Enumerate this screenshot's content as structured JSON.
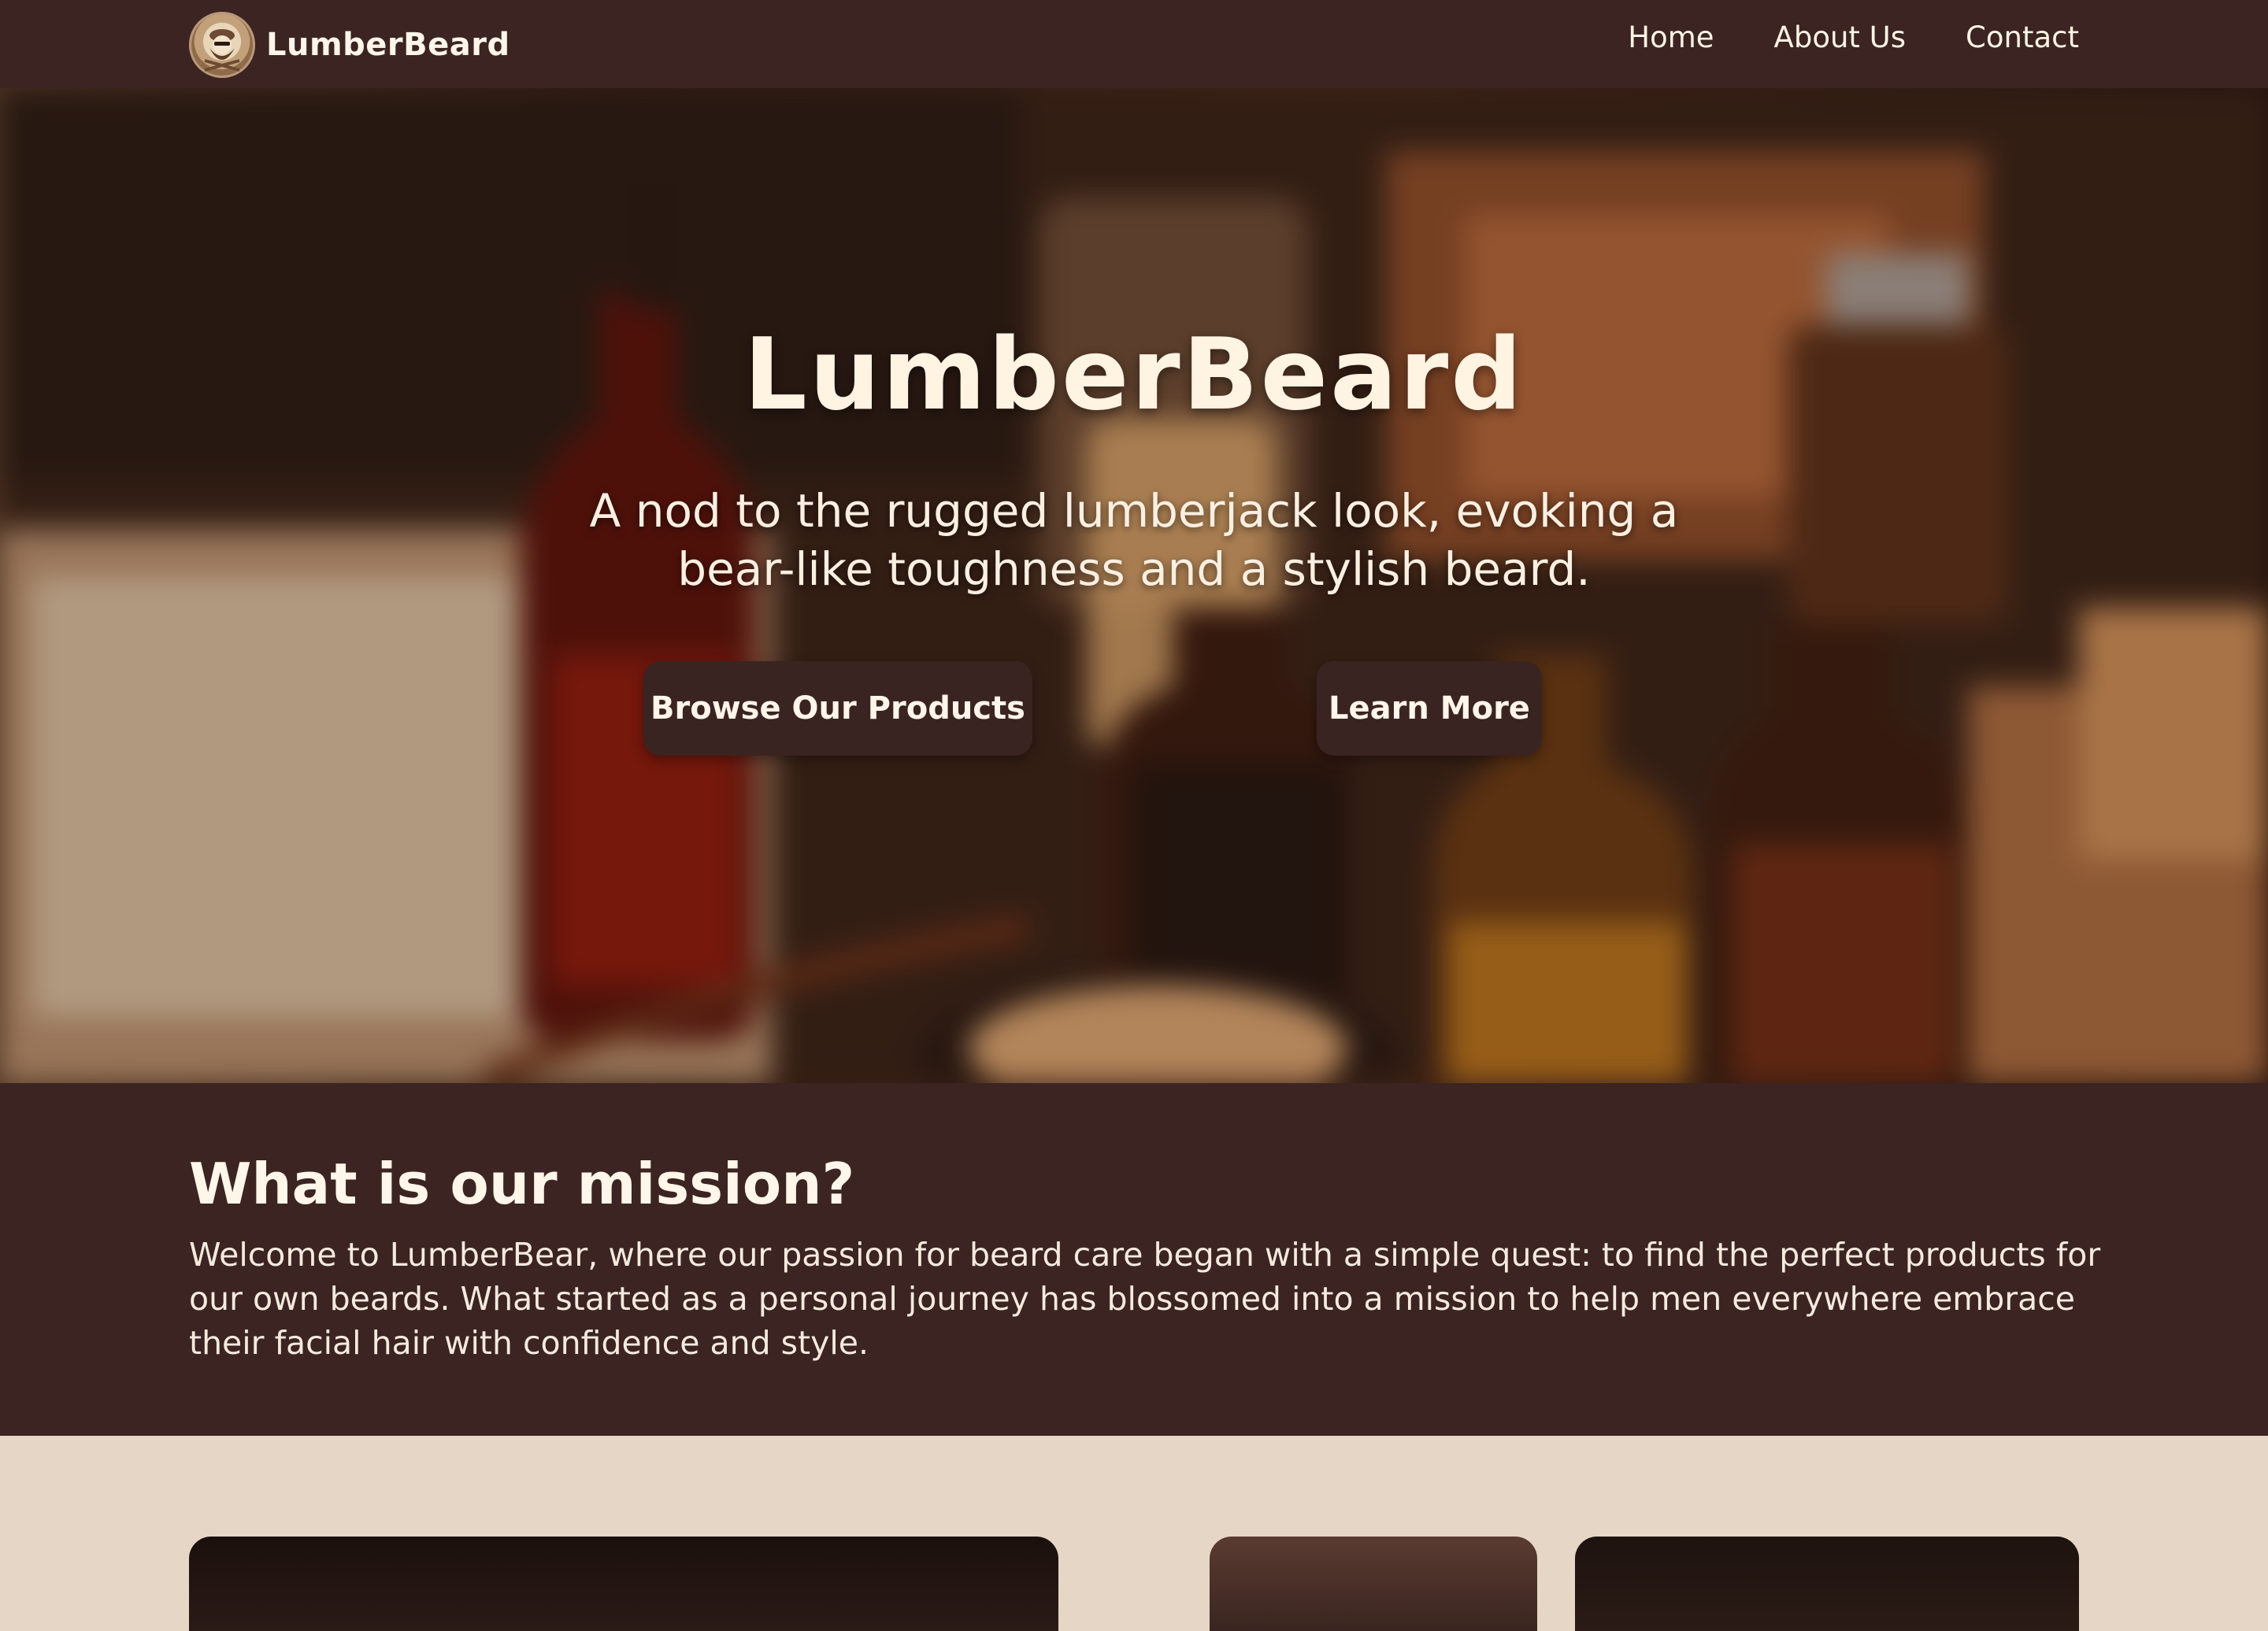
{
  "nav": {
    "brand": "LumberBeard",
    "links": [
      "Home",
      "About Us",
      "Contact"
    ]
  },
  "hero": {
    "title": "LumberBeard",
    "subtitle": "A nod to the rugged lumberjack look, evoking a bear-like toughness and a stylish beard.",
    "buttons": [
      "Browse Our Products",
      "Learn More"
    ]
  },
  "mission": {
    "title": "What is our mission?",
    "text": "Welcome to LumberBear, where our passion for beard care began with a simple quest: to find the perfect products for our own beards. What started as a personal journey has blossomed into a mission to help men everywhere embrace their facial hair with confidence and style."
  },
  "colors": {
    "navbar": "#3b2421",
    "mission_bg": "#3b2421",
    "page_bg": "#e5d6c6",
    "button_bg": "#3a2421",
    "text_light": "#fff5ea"
  },
  "icons": {
    "logo": "bearded-man-logo-icon"
  }
}
